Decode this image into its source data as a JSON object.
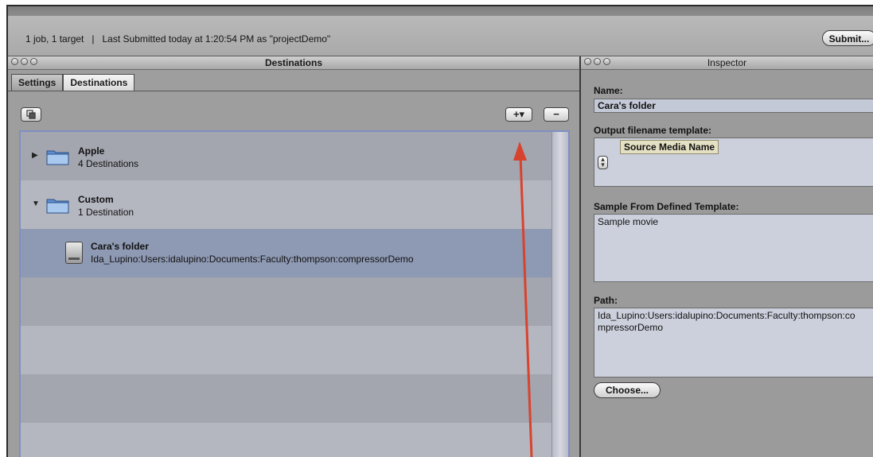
{
  "status": {
    "text": "1 job, 1 target   |   Last Submitted today at 1:20:54 PM as \"projectDemo\"",
    "submit_label": "Submit..."
  },
  "destinations_panel": {
    "title": "Destinations",
    "tabs": [
      {
        "label": "Settings",
        "active": false
      },
      {
        "label": "Destinations",
        "active": true
      }
    ],
    "add_label": "+▾",
    "remove_label": "−",
    "groups": [
      {
        "name": "Apple",
        "count_label": "4 Destinations",
        "expanded": false
      },
      {
        "name": "Custom",
        "count_label": "1 Destination",
        "expanded": true
      }
    ],
    "selected_item": {
      "name": "Cara's folder",
      "path": "Ida_Lupino:Users:idalupino:Documents:Faculty:thompson:compressorDemo"
    }
  },
  "inspector": {
    "title": "Inspector",
    "name_label": "Name:",
    "name_value": "Cara's folder",
    "template_label": "Output filename template:",
    "template_token": "Source Media Name",
    "sample_label": "Sample From Defined Template:",
    "sample_value": "Sample movie",
    "path_label": "Path:",
    "path_line1": "Ida_Lupino:Users:idalupino:Documents:Faculty:thompson:co",
    "path_line2": "mpressorDemo",
    "choose_label": "Choose..."
  },
  "colors": {
    "annotation_arrow": "#d8432e",
    "selection": "#8e99b3",
    "list_border": "#7f8fc2"
  }
}
